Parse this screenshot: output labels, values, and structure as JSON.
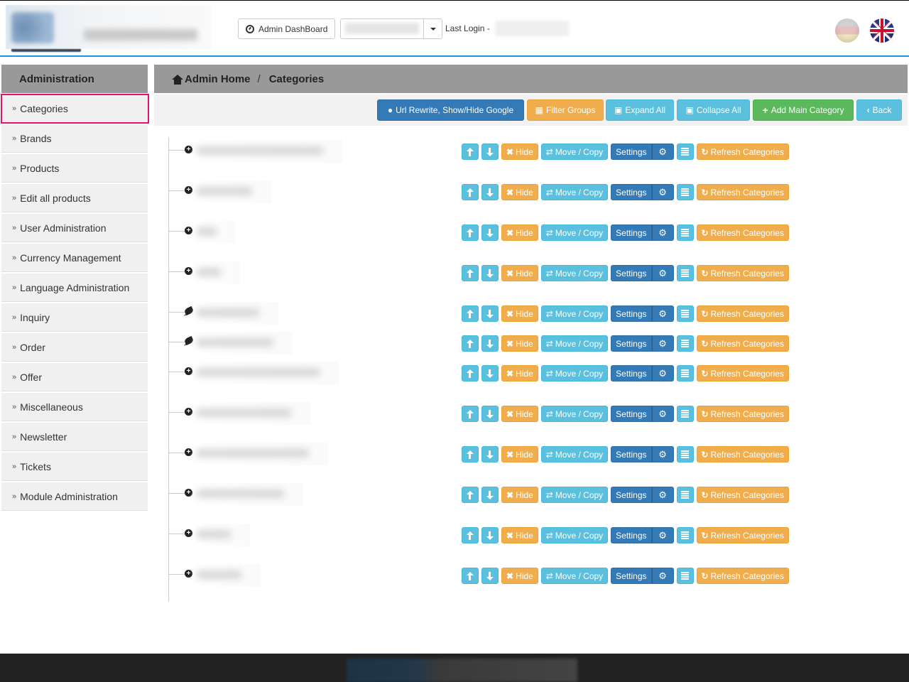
{
  "header": {
    "dashboard_button": "Admin DashBoard",
    "last_login_label": "Last Login - ",
    "languages": [
      {
        "code": "de",
        "name": "German"
      },
      {
        "code": "gb",
        "name": "English"
      }
    ]
  },
  "sidebar": {
    "title": "Administration",
    "bullet": "»",
    "items": [
      {
        "label": "Categories",
        "active": true
      },
      {
        "label": "Brands",
        "active": false
      },
      {
        "label": "Products",
        "active": false
      },
      {
        "label": "Edit all products",
        "active": false
      },
      {
        "label": "User Administration",
        "active": false
      },
      {
        "label": "Currency Management",
        "active": false
      },
      {
        "label": "Language Administration",
        "active": false
      },
      {
        "label": "Inquiry",
        "active": false
      },
      {
        "label": "Order",
        "active": false
      },
      {
        "label": "Offer",
        "active": false
      },
      {
        "label": "Miscellaneous",
        "active": false
      },
      {
        "label": "Newsletter",
        "active": false
      },
      {
        "label": "Tickets",
        "active": false
      },
      {
        "label": "Module Administration",
        "active": false
      }
    ]
  },
  "breadcrumb": {
    "home": "Admin Home",
    "separator": "/",
    "current": "Categories"
  },
  "toolbar": {
    "url_rewrite": "Url Rewrite, Show/Hide Google",
    "filter_groups": "Filter Groups",
    "expand_all": "Expand All",
    "collapse_all": "Collapse All",
    "add_main_category": "Add Main Category",
    "back": "Back"
  },
  "row_actions": {
    "hide": "Hide",
    "move_copy": "Move / Copy",
    "settings": "Settings",
    "refresh": "Refresh Categories"
  },
  "colors": {
    "primary": "#337ab7",
    "warning": "#f0ad4e",
    "info": "#5bc0de",
    "success": "#5cb85c",
    "active_outline": "#e8106e",
    "header_line": "#1a95e0"
  },
  "categories": [
    {
      "node": "expandable",
      "name_blurred": true
    },
    {
      "node": "expandable",
      "name_blurred": true
    },
    {
      "node": "expandable",
      "name_blurred": true
    },
    {
      "node": "expandable",
      "name_blurred": true
    },
    {
      "node": "leaf",
      "name_blurred": true
    },
    {
      "node": "leaf",
      "name_blurred": true
    },
    {
      "node": "expandable",
      "name_blurred": true
    },
    {
      "node": "expandable",
      "name_blurred": true
    },
    {
      "node": "expandable",
      "name_blurred": true
    },
    {
      "node": "expandable",
      "name_blurred": true
    },
    {
      "node": "expandable",
      "name_blurred": true
    },
    {
      "node": "expandable",
      "name_blurred": true
    }
  ]
}
